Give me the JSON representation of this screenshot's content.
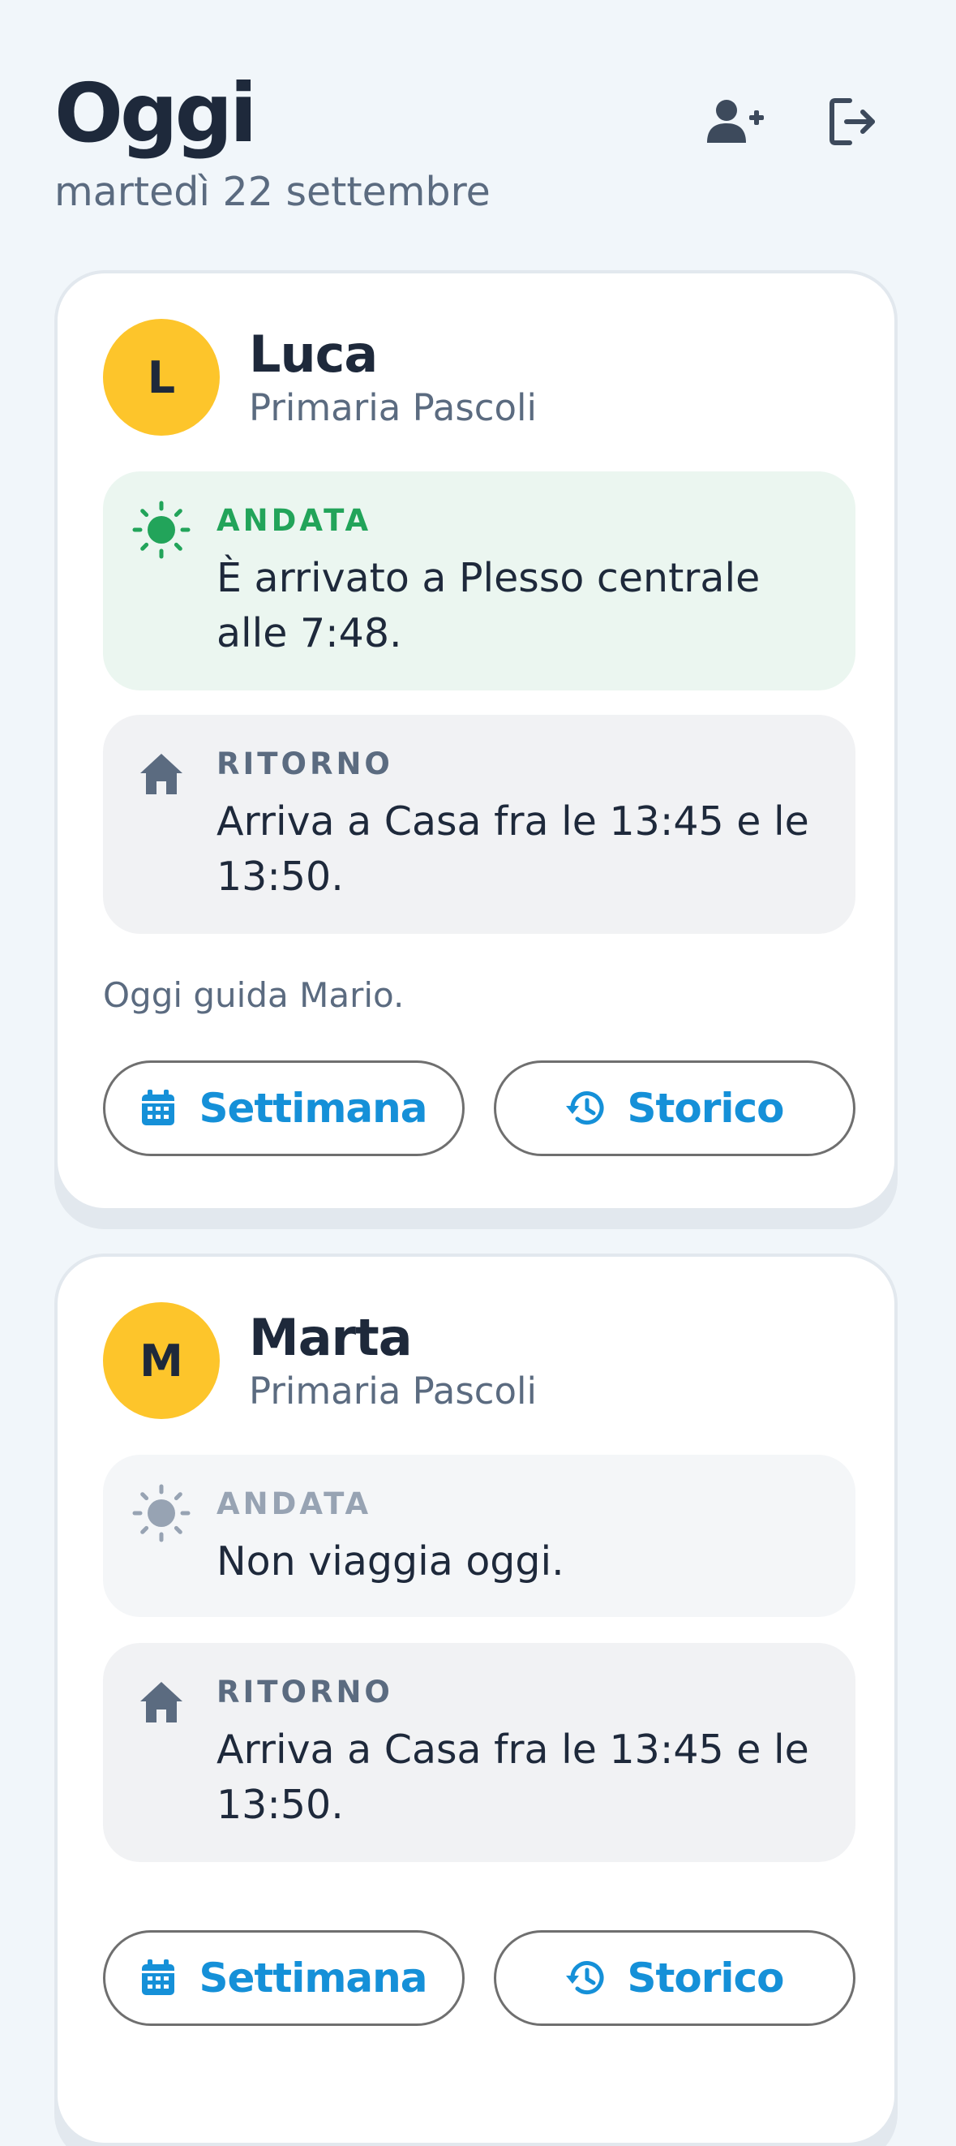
{
  "header": {
    "title": "Oggi",
    "date": "martedì 22 settembre",
    "add_user_icon": "user-plus-icon",
    "logout_icon": "logout-icon"
  },
  "colors": {
    "background": "#f1f6fa",
    "avatar": "#fdc52b",
    "accent_blue": "#1590d8",
    "andata_green": "#22a45a",
    "andata_green_bg": "#ebf6f0",
    "ritorno_bg": "#f1f2f4",
    "text_dark": "#1e293b",
    "text_muted": "#5b6b80"
  },
  "children": [
    {
      "initial": "L",
      "name": "Luca",
      "school": "Primaria Pascoli",
      "andata": {
        "label": "ANDATA",
        "icon": "sun-icon",
        "status": "arrived",
        "text": "È arrivato a Plesso centrale alle 7:48."
      },
      "ritorno": {
        "label": "RITORNO",
        "icon": "home-icon",
        "text": "Arriva a Casa fra le 13:45 e le 13:50."
      },
      "note": "Oggi guida Mario.",
      "buttons": {
        "week_label": "Settimana",
        "week_icon": "calendar-icon",
        "history_label": "Storico",
        "history_icon": "history-icon"
      }
    },
    {
      "initial": "M",
      "name": "Marta",
      "school": "Primaria Pascoli",
      "andata": {
        "label": "ANDATA",
        "icon": "sun-icon",
        "status": "not-travelling",
        "text": "Non viaggia oggi."
      },
      "ritorno": {
        "label": "RITORNO",
        "icon": "home-icon",
        "text": "Arriva a Casa fra le 13:45 e le 13:50."
      },
      "buttons": {
        "week_label": "Settimana",
        "week_icon": "calendar-icon",
        "history_label": "Storico",
        "history_icon": "history-icon"
      }
    }
  ]
}
